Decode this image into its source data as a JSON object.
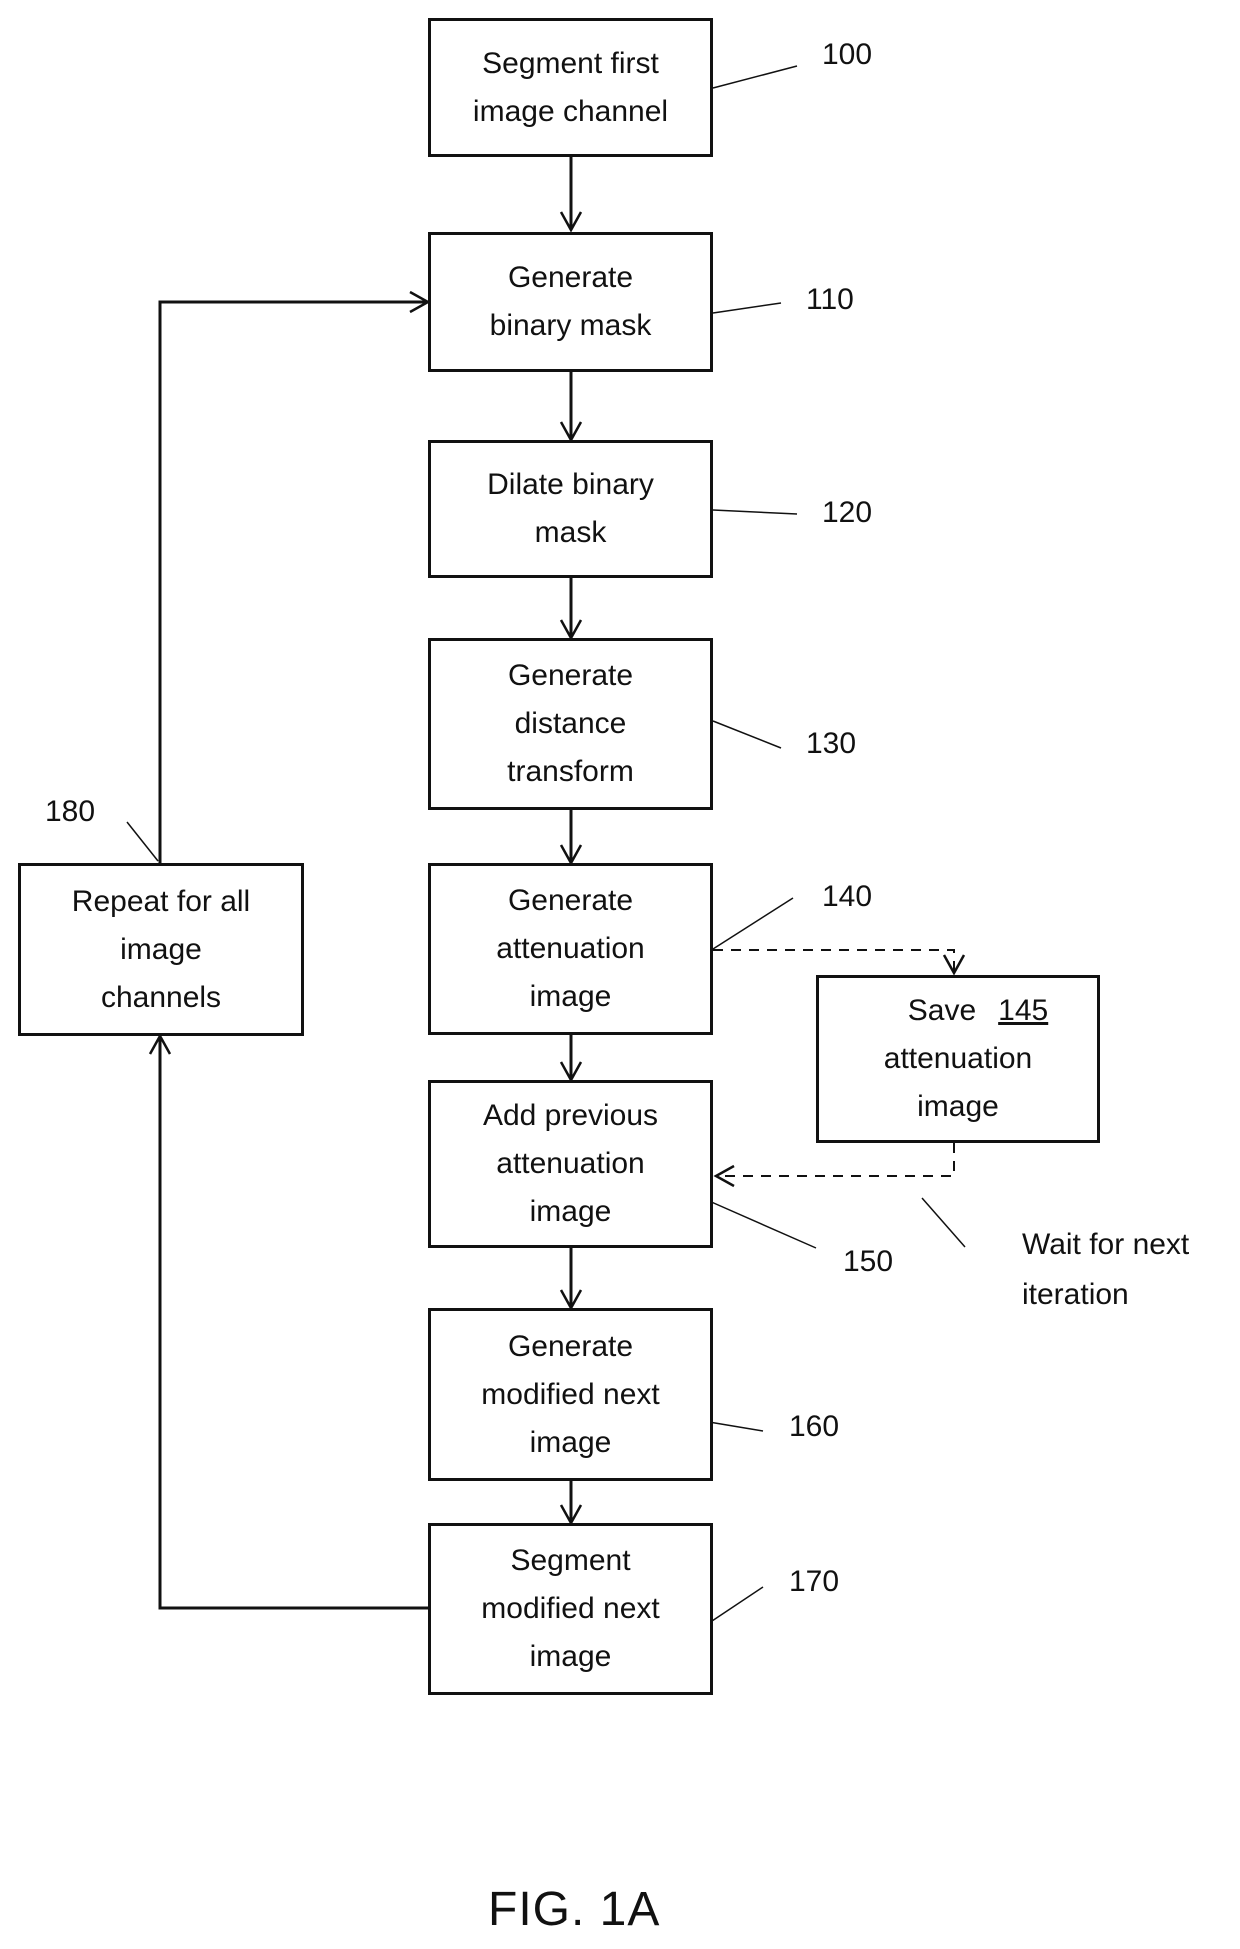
{
  "figure_label": "FIG. 1A",
  "steps": [
    {
      "id": "100",
      "lines": [
        "Segment first",
        "image channel"
      ]
    },
    {
      "id": "110",
      "lines": [
        "Generate",
        "binary mask"
      ]
    },
    {
      "id": "120",
      "lines": [
        "Dilate binary",
        "mask"
      ]
    },
    {
      "id": "130",
      "lines": [
        "Generate",
        "distance",
        "transform"
      ]
    },
    {
      "id": "140",
      "lines": [
        "Generate",
        "attenuation",
        "image"
      ]
    },
    {
      "id": "150",
      "lines": [
        "Add previous",
        "attenuation",
        "image"
      ]
    },
    {
      "id": "160",
      "lines": [
        "Generate",
        "modified next",
        "image"
      ]
    },
    {
      "id": "170",
      "lines": [
        "Segment",
        "modified next",
        "image"
      ]
    }
  ],
  "repeat_step": {
    "id": "180",
    "lines": [
      "Repeat for all",
      "image",
      "channels"
    ]
  },
  "save_step": {
    "id": "145",
    "lines": [
      "Save",
      "attenuation",
      "image"
    ]
  },
  "wait_note": {
    "lines": [
      "Wait for next",
      "iteration"
    ]
  },
  "ref_labels": {
    "r100": "100",
    "r110": "110",
    "r120": "120",
    "r130": "130",
    "r140": "140",
    "r150": "150",
    "r160": "160",
    "r170": "170",
    "r180": "180"
  }
}
